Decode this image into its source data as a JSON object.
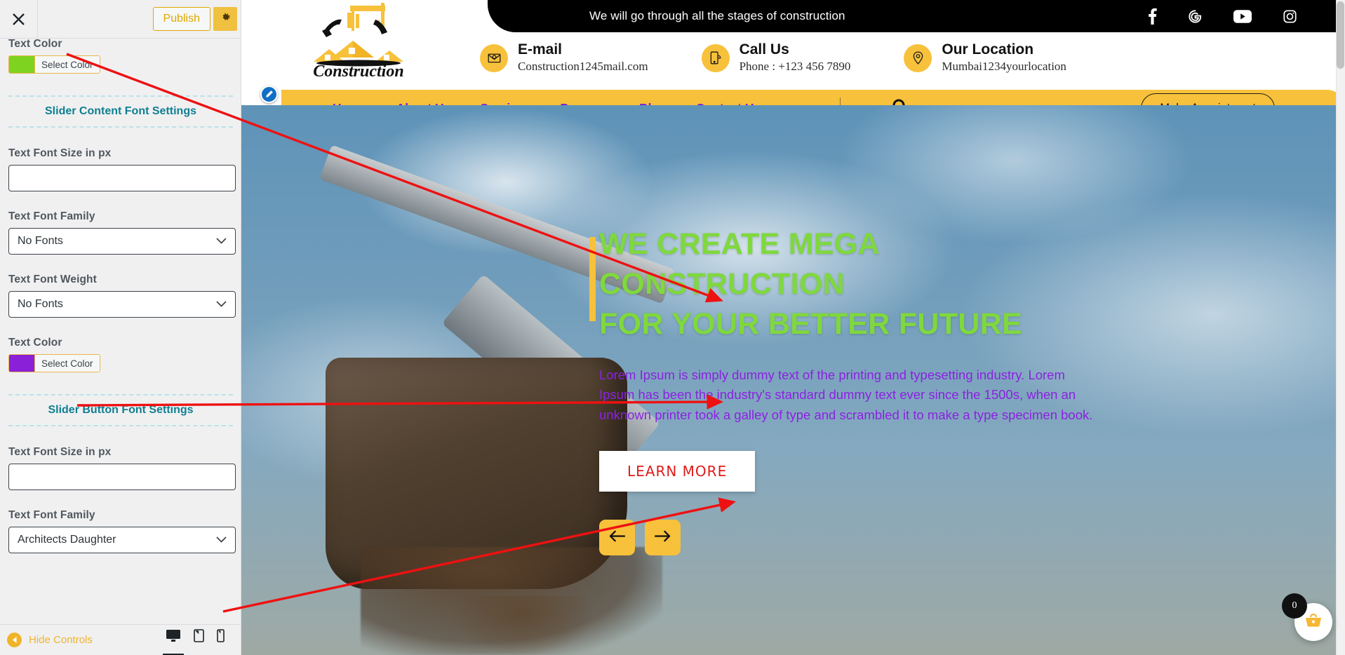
{
  "customizer": {
    "close_icon": "close-icon",
    "publish_label": "Publish",
    "gear_icon": "gear-icon",
    "fields": [
      {
        "type": "color",
        "label": "Text Color",
        "value": "#7ed321",
        "button": "Select Color"
      },
      {
        "type": "section",
        "label": "Slider Content Font Settings"
      },
      {
        "type": "input",
        "label": "Text Font Size in px",
        "value": "",
        "placeholder": ""
      },
      {
        "type": "select",
        "label": "Text Font Family",
        "value": "No Fonts"
      },
      {
        "type": "select",
        "label": "Text Font Weight",
        "value": "No Fonts"
      },
      {
        "type": "color",
        "label": "Text Color",
        "value": "#8a20d8",
        "button": "Select Color"
      },
      {
        "type": "section",
        "label": "Slider Button Font Settings"
      },
      {
        "type": "input",
        "label": "Text Font Size in px",
        "value": "",
        "placeholder": ""
      },
      {
        "type": "select",
        "label": "Text Font Family",
        "value": "Architects Daughter"
      }
    ],
    "bottom": {
      "hide_controls_label": "Hide Controls",
      "devices": [
        {
          "name": "desktop-preview",
          "icon": "desktop-icon",
          "active": true
        },
        {
          "name": "tablet-preview",
          "icon": "tablet-icon",
          "active": false
        },
        {
          "name": "mobile-preview",
          "icon": "mobile-icon",
          "active": false
        }
      ]
    }
  },
  "site": {
    "topbar": {
      "message": "We will go through all the stages of construction",
      "social": [
        {
          "name": "facebook-icon",
          "label": "Facebook"
        },
        {
          "name": "google-icon",
          "label": "Google"
        },
        {
          "name": "youtube-icon",
          "label": "YouTube"
        },
        {
          "name": "instagram-icon",
          "label": "Instagram"
        }
      ]
    },
    "logo_text": "Construction",
    "contacts": [
      {
        "icon": "email-icon",
        "title": "E-mail",
        "value": "Construction1245mail.com"
      },
      {
        "icon": "phone-icon",
        "title": "Call Us",
        "value": "Phone : +123 456 7890"
      },
      {
        "icon": "location-icon",
        "title": "Our Location",
        "value": "Mumbai1234yourlocation"
      }
    ],
    "nav": {
      "links": [
        {
          "label": "Home",
          "has_dropdown": false
        },
        {
          "label": "About Us",
          "has_dropdown": false
        },
        {
          "label": "Services",
          "has_dropdown": false
        },
        {
          "label": "Pages",
          "has_dropdown": true
        },
        {
          "label": "Blog",
          "has_dropdown": false
        },
        {
          "label": "Contact Us",
          "has_dropdown": false
        }
      ],
      "search_icon": "search-icon",
      "appointment_label": "Make Appointment"
    },
    "hero": {
      "title_line1": "WE CREATE MEGA CONSTRUCTION",
      "title_line2": "FOR YOUR BETTER FUTURE",
      "description": "Lorem Ipsum is simply dummy text of the printing and typesetting industry. Lorem Ipsum has been the industry's standard dummy text ever since the 1500s, when an unknown printer took a galley of type and scrambled it to make a type specimen book.",
      "button_label": "LEARN MORE",
      "prev_icon": "arrow-left-icon",
      "next_icon": "arrow-right-icon"
    },
    "cart": {
      "icon": "shopping-basket-icon",
      "count": "0"
    }
  },
  "colors": {
    "brand_yellow": "#f7c13b",
    "title_green": "#7fd83d",
    "body_purple": "#8b22e0",
    "button_red": "#e01b1b",
    "nav_purple": "#7a20d8",
    "annotation_red": "#ee1111"
  }
}
